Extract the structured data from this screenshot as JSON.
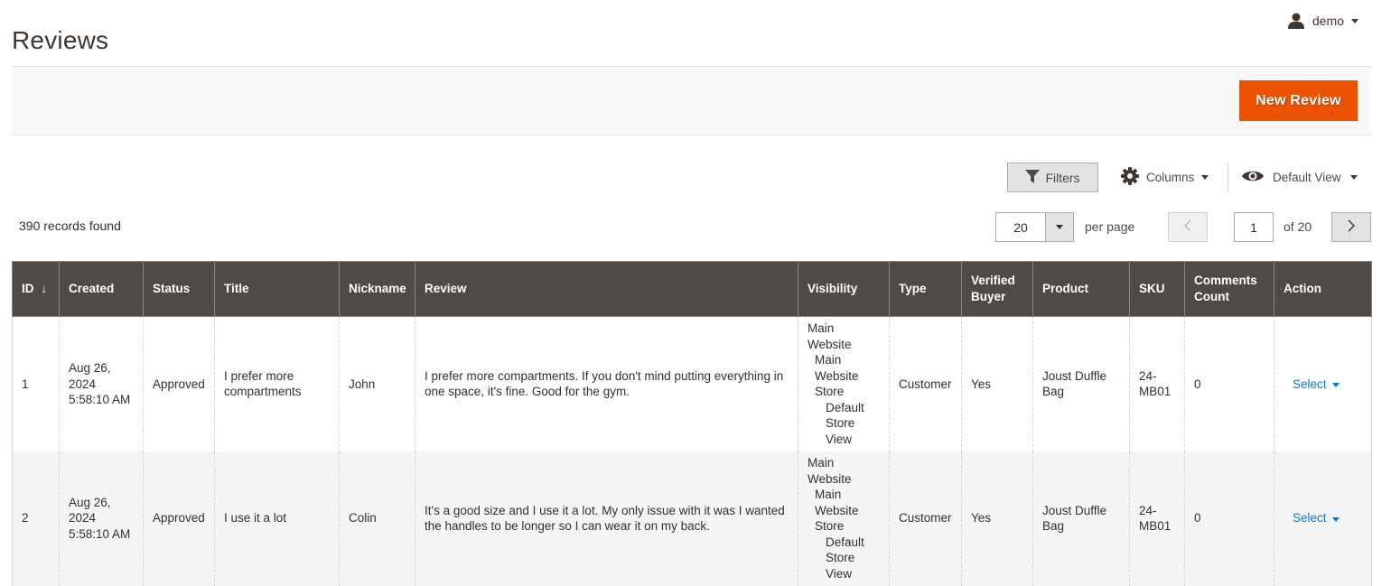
{
  "page": {
    "title": "Reviews"
  },
  "admin_user": {
    "name": "demo",
    "icon": "user-icon"
  },
  "page_actions": {
    "new_review_label": "New Review"
  },
  "colors": {
    "primary_button": "#eb5202",
    "table_header": "#514943",
    "link": "#007bdb"
  },
  "toolbar": {
    "filters_label": "Filters",
    "columns_label": "Columns",
    "view_label": "Default View",
    "records_found": "390 records found",
    "per_page_value": "20",
    "per_page_label": "per page",
    "current_page": "1",
    "total_pages_label": "of 20"
  },
  "grid": {
    "columns": [
      {
        "key": "id",
        "label": "ID",
        "sort_indicator": "↓"
      },
      {
        "key": "created",
        "label": "Created"
      },
      {
        "key": "status",
        "label": "Status"
      },
      {
        "key": "title",
        "label": "Title"
      },
      {
        "key": "nickname",
        "label": "Nickname"
      },
      {
        "key": "review",
        "label": "Review"
      },
      {
        "key": "visibility",
        "label": "Visibility"
      },
      {
        "key": "type",
        "label": "Type"
      },
      {
        "key": "verified_buyer",
        "label": "Verified Buyer"
      },
      {
        "key": "product",
        "label": "Product"
      },
      {
        "key": "sku",
        "label": "SKU"
      },
      {
        "key": "comments_count",
        "label": "Comments Count"
      },
      {
        "key": "action",
        "label": "Action"
      }
    ],
    "rows": [
      {
        "id": "1",
        "created": "Aug 26, 2024 5:58:10 AM",
        "status": "Approved",
        "title": "I prefer more compartments",
        "nickname": "John",
        "review": "I prefer more compartments. If you don't mind putting everything in one space, it's fine. Good for the gym.",
        "visibility": [
          "Main Website",
          "Main Website Store",
          "Default Store View"
        ],
        "type": "Customer",
        "verified_buyer": "Yes",
        "product": "Joust Duffle Bag",
        "sku": "24-MB01",
        "comments_count": "0",
        "action": "Select"
      },
      {
        "id": "2",
        "created": "Aug 26, 2024 5:58:10 AM",
        "status": "Approved",
        "title": "I use it a lot",
        "nickname": "Colin",
        "review": "It's a good size and I use it a lot. My only issue with it was I wanted the handles to be longer so I can wear it on my back.",
        "visibility": [
          "Main Website",
          "Main Website Store",
          "Default Store View"
        ],
        "type": "Customer",
        "verified_buyer": "Yes",
        "product": "Joust Duffle Bag",
        "sku": "24-MB01",
        "comments_count": "0",
        "action": "Select"
      }
    ]
  }
}
